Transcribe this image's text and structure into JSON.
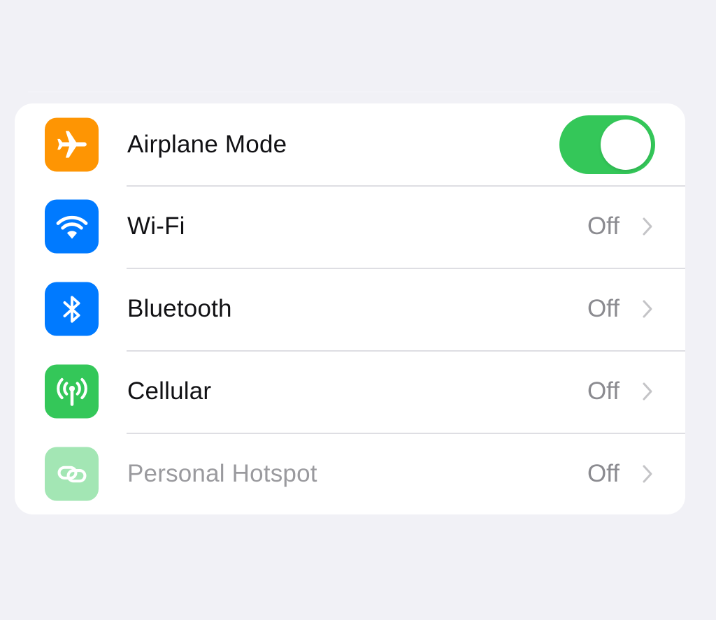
{
  "settings": {
    "rows": [
      {
        "label": "Airplane Mode",
        "icon": "airplane-icon",
        "icon_bg": "#fe9503",
        "control": "toggle",
        "toggle_on": true,
        "toggle_color": "#34c759"
      },
      {
        "label": "Wi-Fi",
        "value": "Off",
        "icon": "wifi-icon",
        "icon_bg": "#007aff",
        "control": "disclosure"
      },
      {
        "label": "Bluetooth",
        "value": "Off",
        "icon": "bluetooth-icon",
        "icon_bg": "#007aff",
        "control": "disclosure"
      },
      {
        "label": "Cellular",
        "value": "Off",
        "icon": "cellular-antenna-icon",
        "icon_bg": "#34c759",
        "control": "disclosure"
      },
      {
        "label": "Personal Hotspot",
        "value": "Off",
        "icon": "hotspot-link-icon",
        "icon_bg": "#34c759",
        "control": "disclosure",
        "disabled": true
      }
    ]
  }
}
